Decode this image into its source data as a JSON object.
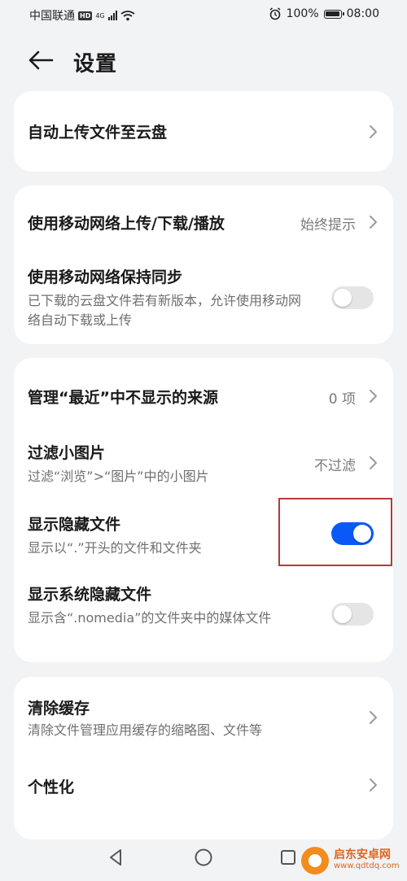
{
  "status_bar": {
    "carrier": "中国联通",
    "hd": "HD",
    "network": "4G",
    "battery": "100%",
    "time": "08:00"
  },
  "header": {
    "title": "设置"
  },
  "sections": {
    "s1": {
      "auto_upload": {
        "title": "自动上传文件至云盘"
      }
    },
    "s2": {
      "mobile_network": {
        "title": "使用移动网络上传/下载/播放",
        "value": "始终提示"
      },
      "mobile_sync": {
        "title": "使用移动网络保持同步",
        "subtitle": "已下载的云盘文件若有新版本，允许使用移动网络自动下载或上传",
        "enabled": false
      }
    },
    "s3": {
      "recent_sources": {
        "title": "管理“最近”中不显示的来源",
        "value": "0 项"
      },
      "filter_images": {
        "title": "过滤小图片",
        "subtitle": "过滤“浏览”>“图片”中的小图片",
        "value": "不过滤"
      },
      "show_hidden": {
        "title": "显示隐藏文件",
        "subtitle": "显示以“.”开头的文件和文件夹",
        "enabled": true
      },
      "show_system_hidden": {
        "title": "显示系统隐藏文件",
        "subtitle": "显示含“.nomedia”的文件夹中的媒体文件",
        "enabled": false
      }
    },
    "s4": {
      "clear_cache": {
        "title": "清除缓存",
        "subtitle": "清除文件管理应用缓存的缩略图、文件等"
      },
      "personalize": {
        "title": "个性化"
      }
    }
  },
  "colors": {
    "accent": "#0a59f7",
    "highlight": "#b43a3a",
    "background": "#f1f3f5"
  },
  "watermark": {
    "name": "启东安卓网",
    "url": "www.qdtdq.com"
  }
}
